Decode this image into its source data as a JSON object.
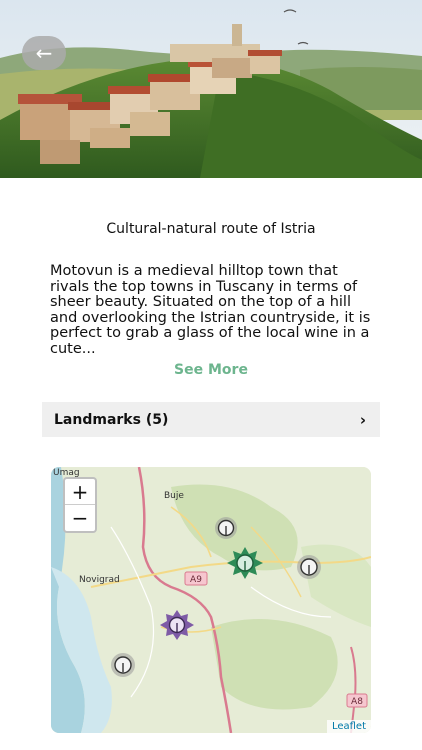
{
  "header": {
    "back_icon": "arrow-left-icon"
  },
  "route": {
    "title": "Cultural-natural route of Istria",
    "description": "Motovun is a medieval hilltop town that rivals the top towns in Tuscany in terms of sheer beauty. Situated on the top of a hill and overlooking the Istrian countryside, it is perfect to grab a glass of the local wine in a cute...",
    "see_more_label": "See More"
  },
  "landmarks": {
    "label": "Landmarks (5)",
    "chevron": "›"
  },
  "map": {
    "zoom_in": "+",
    "zoom_out": "−",
    "attribution": "Leaflet",
    "towns": {
      "umag": "Umag",
      "buje": "Buje",
      "novigrad": "Novigrad"
    },
    "road_labels": {
      "a9": "A9",
      "a8": "A8"
    }
  },
  "colors": {
    "accent": "#6db58e",
    "marker_green": "#2e8b57",
    "marker_purple": "#7e5ba6",
    "marker_gray": "#9a9a9a"
  }
}
